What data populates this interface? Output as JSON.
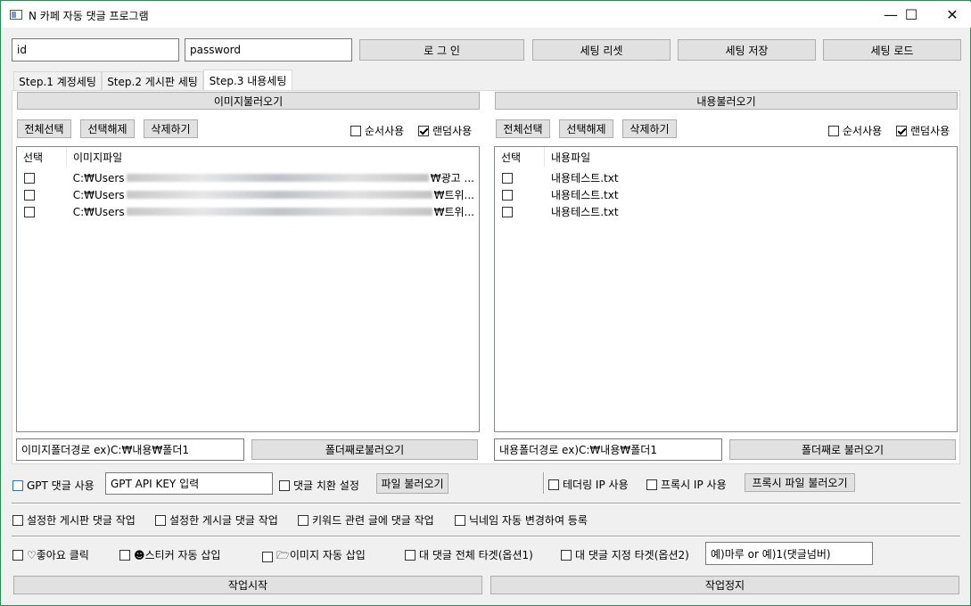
{
  "window": {
    "title": "N 카페 자동 댓글 프로그램",
    "minimize": "—",
    "maximize": "☐",
    "close": "✕"
  },
  "login": {
    "id_value": "id",
    "password_value": "password",
    "login_button": "로 그 인",
    "reset_button": "세팅 리셋",
    "save_button": "세팅 저장",
    "load_button": "세팅 로드"
  },
  "tabs": [
    {
      "label": "Step.1 계정세팅"
    },
    {
      "label": "Step.2 게시판 세팅"
    },
    {
      "label": "Step.3 내용세팅"
    }
  ],
  "image_panel": {
    "load_button": "이미지불러오기",
    "select_all": "전체선택",
    "deselect": "선택해제",
    "delete": "삭제하기",
    "sequential": "순서사용",
    "random": "랜덤사용",
    "col_select": "선택",
    "col_file": "이미지파일",
    "rows": [
      {
        "prefix": "C:₩Users",
        "suffix": "₩광고 ..."
      },
      {
        "prefix": "C:₩Users",
        "suffix": "₩트위..."
      },
      {
        "prefix": "C:₩Users",
        "suffix": "₩트위..."
      }
    ],
    "folder_path": "이미지폴더경로 ex)C:₩내용₩폴더1",
    "folder_button": "폴더째로불러오기"
  },
  "content_panel": {
    "load_button": "내용불러오기",
    "select_all": "전체선택",
    "deselect": "선택해제",
    "delete": "삭제하기",
    "sequential": "순서사용",
    "random": "랜덤사용",
    "col_select": "선택",
    "col_file": "내용파일",
    "rows": [
      {
        "file": "내용테스트.txt"
      },
      {
        "file": "내용테스트.txt"
      },
      {
        "file": "내용테스트.txt"
      }
    ],
    "folder_path": "내용폴더경로 ex)C:₩내용₩폴더1",
    "folder_button": "폴더째로 불러오기"
  },
  "options": {
    "gpt_use": "GPT 댓글 사용",
    "gpt_key_value": "GPT API KEY 입력",
    "replace_setting": "댓글 치환 설정",
    "file_load": "파일 불러오기",
    "tethering": "테더링 IP 사용",
    "proxy": "프록시 IP 사용",
    "proxy_file": "프록시 파일 불러오기",
    "board_comment": "설정한 게시판 댓글 작업",
    "post_comment": "설정한 게시글 댓글 작업",
    "keyword_comment": "키워드 관련 글에 댓글 작업",
    "nickname_change": "닉네임 자동 변경하여 등록",
    "like_click": "♡좋아요 클릭",
    "sticker_insert": "☻스티커 자동 삽입",
    "image_insert": "🗁이미지 자동 삽입",
    "reply_all": "대 댓글 전체 타겟(옵션1)",
    "reply_target": "대 댓글 지정 타겟(옵션2)",
    "reply_target_value": "예)마루 or 예)1(댓글넘버)",
    "start_button": "작업시작",
    "stop_button": "작업정지"
  }
}
